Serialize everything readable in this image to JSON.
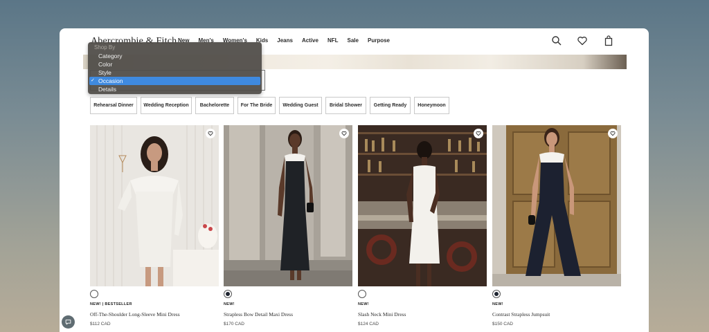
{
  "brand": {
    "logo_text": "Abercrombie & Fitch"
  },
  "nav": [
    "New",
    "Men's",
    "Women's",
    "Kids",
    "Jeans",
    "Active",
    "NFL",
    "Sale",
    "Purpose"
  ],
  "header_icons": [
    "search-icon",
    "heart-icon",
    "bag-icon"
  ],
  "shop_by": {
    "header": "Shop By",
    "options": [
      "Category",
      "Color",
      "Style",
      "Occasion",
      "Details"
    ],
    "selected": "Occasion"
  },
  "filters": [
    "Rehearsal Dinner",
    "Wedding Reception",
    "Bachelorette",
    "For The Bride",
    "Wedding Guest",
    "Bridal Shower",
    "Getting Ready",
    "Honeymoon"
  ],
  "products": [
    {
      "badge": "NEW! | BESTSELLER",
      "name": "Off-The-Shoulder Long-Sleeve Mini Dress",
      "price": "$112 CAD",
      "swatch": "white"
    },
    {
      "badge": "NEW!",
      "name": "Strapless Bow Detail Maxi Dress",
      "price": "$170 CAD",
      "swatch": "dark"
    },
    {
      "badge": "NEW!",
      "name": "Slash Neck Mini Dress",
      "price": "$124 CAD",
      "swatch": "white"
    },
    {
      "badge": "NEW!",
      "name": "Contrast Strapless Jumpsuit",
      "price": "$150 CAD",
      "swatch": "dark"
    }
  ],
  "colors": {
    "page_bg_top": "#5b7687",
    "page_bg_bottom": "#b7ac98",
    "dropdown_bg": "#504c48",
    "dropdown_selected": "#3f8ae0"
  }
}
